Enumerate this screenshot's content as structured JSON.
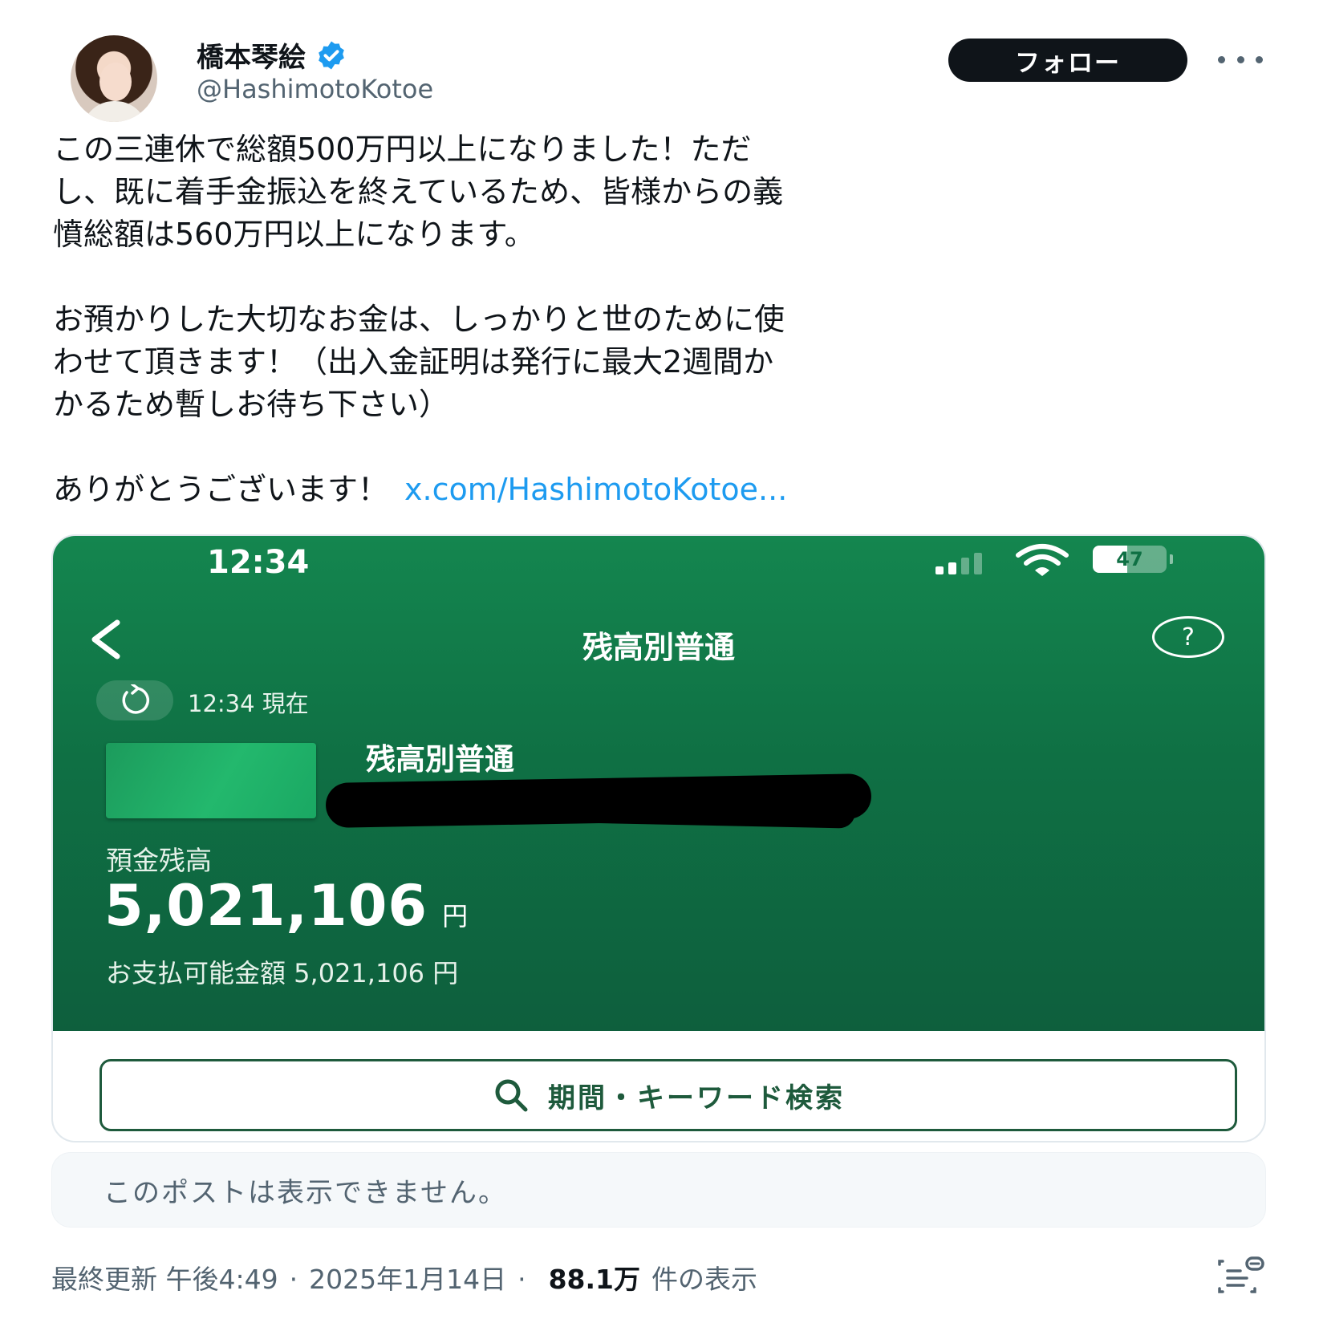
{
  "author": {
    "display_name": "橋本琴絵",
    "handle": "@HashimotoKotoe",
    "verified": true,
    "avatar": "avatar-photo"
  },
  "header": {
    "follow_label": "フォロー",
    "more_icon": "ellipsis-icon"
  },
  "tweet": {
    "lines": [
      "この三連休で総額500万円以上になりました！ただ",
      "し、既に着手金振込を終えているため、皆様からの義",
      "憤総額は560万円以上になります。",
      "",
      "お預かりした大切なお金は、しっかりと世のために使",
      "わせて頂きます！（出入金証明は発行に最大2週間か",
      "かるため暫しお待ち下さい）",
      "",
      "ありがとうございます！"
    ],
    "link_text": "x.com/HashimotoKotoe..."
  },
  "media": {
    "status_time": "12:34",
    "battery": "47",
    "battery_level": 0.47,
    "screen_title": "残高別普通",
    "help_label": "?",
    "as_of": "12:34 現在",
    "account_name": "残高別普通",
    "balance_label": "預金残高",
    "balance_amount": "5,021,106",
    "balance_unit": "円",
    "available_text": "お支払可能金額 5,021,106 円",
    "search_label": "期間・キーワード検索"
  },
  "unavailable_post": "このポストは表示できません。",
  "footer": {
    "updated_label": "最終更新 午後4:49",
    "date": "2025年1月14日",
    "views_count": "88.1万",
    "views_label": "件の表示"
  },
  "colors": {
    "bank_green": "#0f7044",
    "link_blue": "#1d9bf0",
    "verified_blue": "#1d9bf0",
    "text_secondary": "#536471"
  }
}
